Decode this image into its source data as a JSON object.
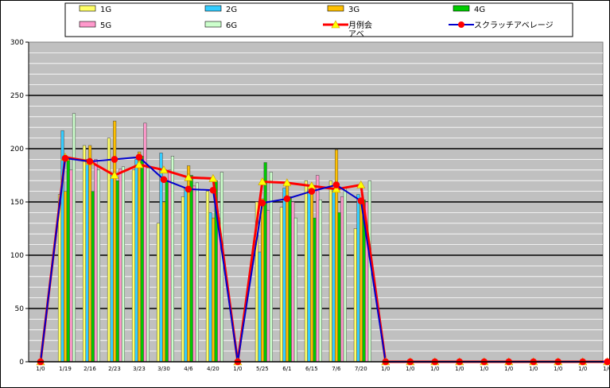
{
  "chart_data": {
    "type": "bar",
    "categories": [
      "1/0",
      "1/19",
      "2/16",
      "2/23",
      "3/23",
      "3/30",
      "4/6",
      "4/20",
      "1/0",
      "5/25",
      "6/1",
      "6/15",
      "7/6",
      "7/20",
      "1/0",
      "1/0",
      "1/0",
      "1/0",
      "1/0",
      "1/0",
      "1/0",
      "1/0",
      "1/0",
      "1/0"
    ],
    "ylim": [
      0,
      300
    ],
    "yticks": [
      0,
      50,
      100,
      150,
      200,
      250,
      300
    ],
    "grid": true,
    "legend_position": "top",
    "series": [
      {
        "name": "1G",
        "kind": "bar",
        "color": "#ffff66",
        "values": [
          0,
          157,
          203,
          210,
          180,
          130,
          155,
          160,
          0,
          150,
          145,
          170,
          170,
          125,
          0,
          0,
          0,
          0,
          0,
          0,
          0,
          0,
          0,
          0
        ]
      },
      {
        "name": "2G",
        "kind": "bar",
        "color": "#33ccff",
        "values": [
          0,
          217,
          190,
          175,
          190,
          196,
          163,
          140,
          0,
          103,
          163,
          162,
          163,
          157,
          0,
          0,
          0,
          0,
          0,
          0,
          0,
          0,
          0,
          0
        ]
      },
      {
        "name": "3G",
        "kind": "bar",
        "color": "#ffc000",
        "values": [
          0,
          160,
          203,
          226,
          197,
          150,
          184,
          135,
          0,
          153,
          165,
          165,
          199,
          153,
          0,
          0,
          0,
          0,
          0,
          0,
          0,
          0,
          0,
          0
        ]
      },
      {
        "name": "4G",
        "kind": "bar",
        "color": "#00cc00",
        "values": [
          0,
          190,
          160,
          170,
          193,
          170,
          175,
          170,
          0,
          187,
          155,
          135,
          140,
          152,
          0,
          0,
          0,
          0,
          0,
          0,
          0,
          0,
          0,
          0
        ]
      },
      {
        "name": "5G",
        "kind": "bar",
        "color": "#ff99cc",
        "values": [
          0,
          180,
          190,
          181,
          224,
          180,
          165,
          135,
          0,
          142,
          150,
          175,
          155,
          150,
          0,
          0,
          0,
          0,
          0,
          0,
          0,
          0,
          0,
          0
        ]
      },
      {
        "name": "6G",
        "kind": "bar",
        "color": "#ccffcc",
        "values": [
          0,
          233,
          180,
          183,
          182,
          193,
          168,
          178,
          0,
          178,
          135,
          152,
          163,
          170,
          0,
          0,
          0,
          0,
          0,
          0,
          0,
          0,
          0,
          0
        ]
      },
      {
        "name": "月例会アベ",
        "kind": "line",
        "color": "#ff0000",
        "marker_color": "#ffff00",
        "values": [
          0,
          192,
          188,
          175,
          185,
          180,
          173,
          172,
          0,
          169,
          168,
          165,
          162,
          166,
          0,
          0,
          0,
          0,
          0,
          0,
          0,
          0,
          0,
          0
        ]
      },
      {
        "name": "スクラッチアベレージ",
        "kind": "line",
        "color": "#0000cc",
        "marker_color": "#ff0000",
        "values": [
          0,
          191,
          188,
          190,
          192,
          171,
          162,
          161,
          0,
          149,
          153,
          160,
          166,
          151,
          0,
          0,
          0,
          0,
          0,
          0,
          0,
          0,
          0,
          0
        ]
      }
    ]
  }
}
